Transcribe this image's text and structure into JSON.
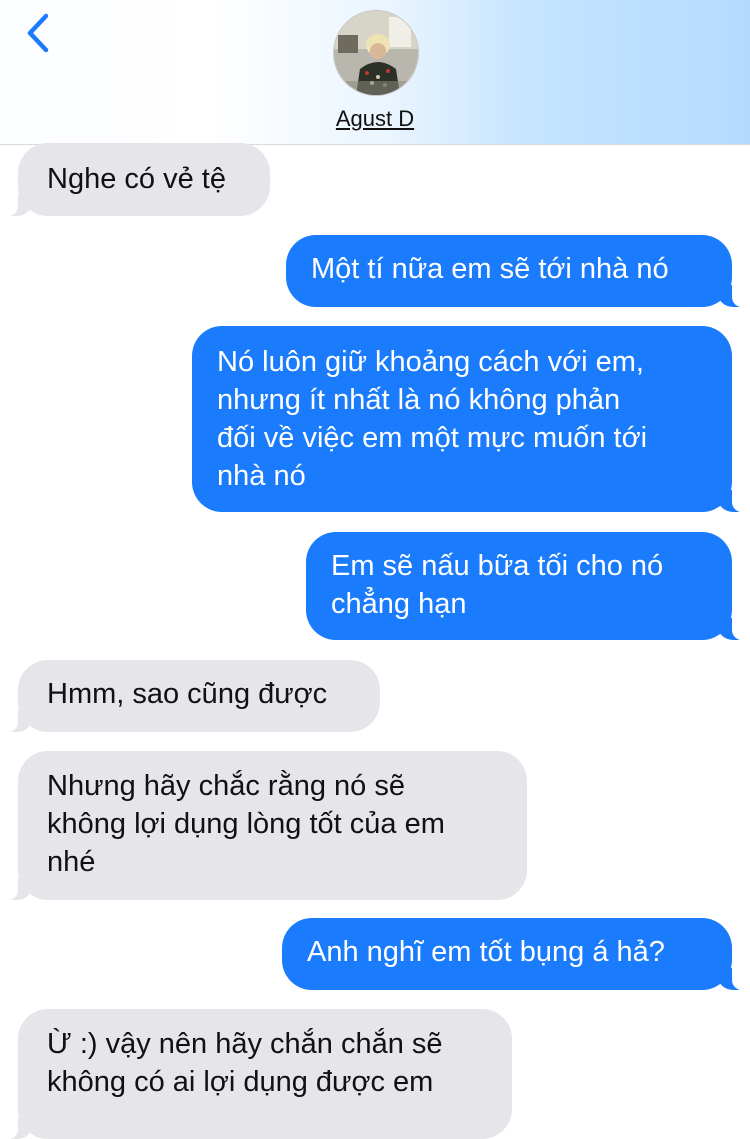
{
  "header": {
    "contact_name": "Agust D",
    "back_icon": "chevron-left-icon",
    "avatar_icon": "contact-avatar-photo"
  },
  "colors": {
    "incoming_bubble": "#e5e5ea",
    "outgoing_bubble": "#1a7cfc",
    "accent": "#1a7cfc"
  },
  "messages": [
    {
      "direction": "incoming",
      "lines": [
        "Nghe có vẻ tệ"
      ]
    },
    {
      "direction": "outgoing",
      "lines": [
        "Một tí nữa em sẽ tới nhà nó"
      ]
    },
    {
      "direction": "outgoing",
      "lines": [
        "Nó luôn giữ khoảng cách với em,",
        "nhưng ít nhất là nó không phản",
        "đối về việc em một mực muốn tới",
        "nhà nó"
      ]
    },
    {
      "direction": "outgoing",
      "lines": [
        "Em sẽ nấu bữa tối cho nó",
        "chẳng hạn"
      ]
    },
    {
      "direction": "incoming",
      "lines": [
        "Hmm, sao cũng được"
      ]
    },
    {
      "direction": "incoming",
      "lines": [
        "Nhưng hãy chắc rằng nó sẽ",
        "không lợi dụng lòng tốt của em",
        "nhé"
      ]
    },
    {
      "direction": "outgoing",
      "lines": [
        "Anh nghĩ em tốt bụng á hả?"
      ]
    },
    {
      "direction": "incoming",
      "lines": [
        "Ừ :) vậy nên hãy chắn chắn sẽ",
        "không có ai lợi dụng được em"
      ]
    }
  ]
}
